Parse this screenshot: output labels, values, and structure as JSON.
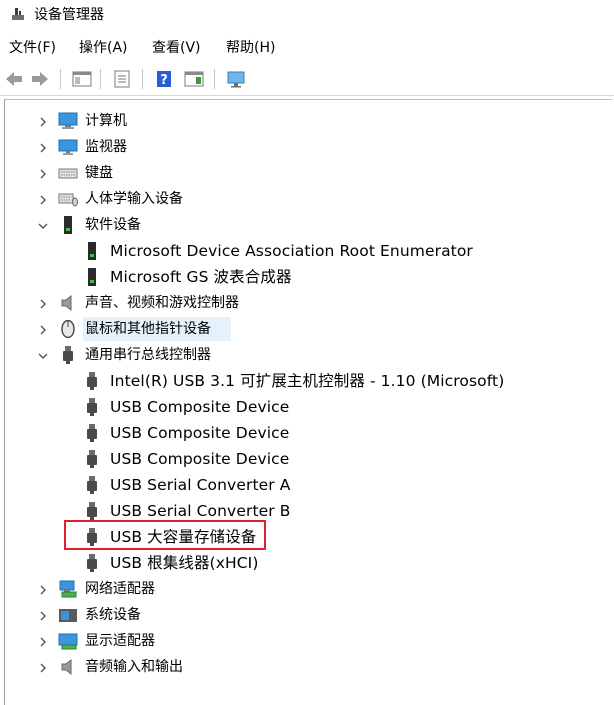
{
  "window": {
    "title": "设备管理器"
  },
  "menu": [
    "文件(F)",
    "操作(A)",
    "查看(V)",
    "帮助(H)"
  ],
  "toolbar": {
    "buttons": [
      "back-icon",
      "forward-icon",
      "console-tree-icon",
      "properties-icon",
      "help-icon",
      "action-pane-icon",
      "monitor-scan-icon"
    ]
  },
  "tree": [
    {
      "label": "计算机",
      "expanded": false,
      "icon": "computer-icon"
    },
    {
      "label": "监视器",
      "expanded": false,
      "icon": "monitor-icon"
    },
    {
      "label": "键盘",
      "expanded": false,
      "icon": "keyboard-icon"
    },
    {
      "label": "人体学输入设备",
      "expanded": false,
      "icon": "hid-icon"
    },
    {
      "label": "软件设备",
      "expanded": true,
      "icon": "software-device-icon",
      "children": [
        "Microsoft Device Association Root Enumerator",
        "Microsoft GS 波表合成器"
      ]
    },
    {
      "label": "声音、视频和游戏控制器",
      "expanded": false,
      "icon": "speaker-icon"
    },
    {
      "label": "鼠标和其他指针设备",
      "expanded": false,
      "icon": "mouse-icon",
      "selected": true
    },
    {
      "label": "通用串行总线控制器",
      "expanded": true,
      "icon": "usb-icon",
      "children": [
        "Intel(R) USB 3.1 可扩展主机控制器 - 1.10 (Microsoft)",
        "USB Composite Device",
        "USB Composite Device",
        "USB Composite Device",
        "USB Serial Converter A",
        "USB Serial Converter B",
        "USB 大容量存储设备",
        "USB 根集线器(xHCI)"
      ]
    },
    {
      "label": "网络适配器",
      "expanded": false,
      "icon": "network-icon"
    },
    {
      "label": "系统设备",
      "expanded": false,
      "icon": "system-device-icon"
    },
    {
      "label": "显示适配器",
      "expanded": false,
      "icon": "display-adapter-icon"
    },
    {
      "label": "音频输入和输出",
      "expanded": false,
      "icon": "audio-io-icon"
    }
  ],
  "highlight": {
    "item": "USB 大容量存储设备",
    "color": "#e2202a"
  },
  "colors": {
    "selection": "#e5f1fb",
    "chevron": "#555555",
    "usbIcon": "#4a4a4a",
    "monitorBlue": "#2f8fd8"
  }
}
